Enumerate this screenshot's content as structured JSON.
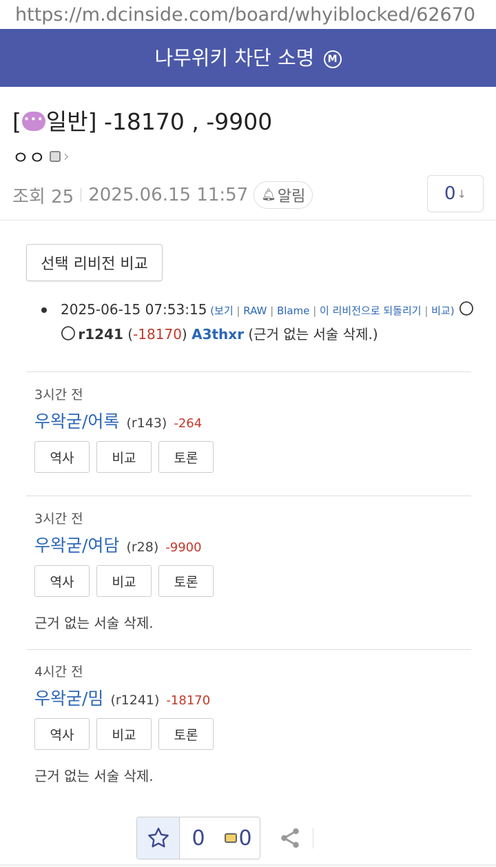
{
  "url": "https://m.dcinside.com/board/whyiblocked/62670",
  "gallery": {
    "title": "나무위키 차단 소명",
    "badge": "M"
  },
  "post": {
    "title_prefix_open": "[",
    "title_prefix_label": "일반]",
    "title_text": " -18170 , -9900",
    "author": "ㅇㅇ",
    "views_label": "조회 25",
    "datetime": "2025.06.15 11:57",
    "alarm_label": "알림",
    "comment_count": "0"
  },
  "revision": {
    "compare_button": "선택 리비전 비교",
    "timestamp": "2025-06-15 07:53:15",
    "paren_open": " (",
    "links": [
      "보기",
      "RAW",
      "Blame",
      "이 리비전으로 되돌리기",
      "비교"
    ],
    "paren_close": ")",
    "author": "〇〇",
    "rev_no": "r1241",
    "diff_open": " (",
    "diff": "-18170",
    "diff_close": ")",
    "user": "A3thxr",
    "summary": " (근거 없는 서술 삭제.)"
  },
  "feed": [
    {
      "time": "3시간 전",
      "doc": "우왁굳/어록",
      "rev": "(r143)",
      "diff": "-264",
      "buttons": [
        "역사",
        "비교",
        "토론"
      ],
      "summary": ""
    },
    {
      "time": "3시간 전",
      "doc": "우왁굳/여담",
      "rev": "(r28)",
      "diff": "-9900",
      "buttons": [
        "역사",
        "비교",
        "토론"
      ],
      "summary": "근거 없는 서술 삭제."
    },
    {
      "time": "4시간 전",
      "doc": "우왁굳/밈",
      "rev": "(r1241)",
      "diff": "-18170",
      "buttons": [
        "역사",
        "비교",
        "토론"
      ],
      "summary": "근거 없는 서술 삭제."
    }
  ],
  "bottom": {
    "recommend_count": "0",
    "fix_count": "0"
  },
  "colors": {
    "header_bg": "#4b59a8",
    "link": "#2c67b6",
    "diff_negative": "#c0392b",
    "count": "#3b4890"
  },
  "icons": [
    "chat-emoji-icon",
    "author-badge-icon",
    "bell-icon",
    "down-arrow-icon",
    "star-icon",
    "fix-icon",
    "share-icon"
  ]
}
